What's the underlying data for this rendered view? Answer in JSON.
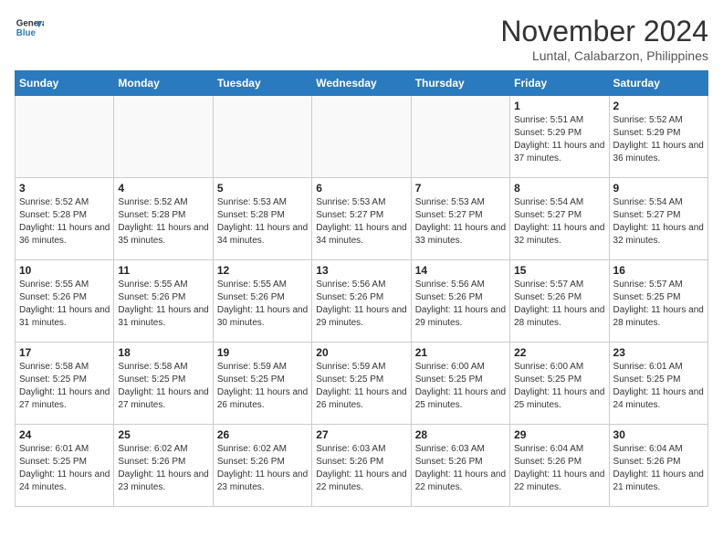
{
  "header": {
    "logo_line1": "General",
    "logo_line2": "Blue",
    "title": "November 2024",
    "subtitle": "Luntal, Calabarzon, Philippines"
  },
  "days_of_week": [
    "Sunday",
    "Monday",
    "Tuesday",
    "Wednesday",
    "Thursday",
    "Friday",
    "Saturday"
  ],
  "weeks": [
    [
      {
        "day": "",
        "info": ""
      },
      {
        "day": "",
        "info": ""
      },
      {
        "day": "",
        "info": ""
      },
      {
        "day": "",
        "info": ""
      },
      {
        "day": "",
        "info": ""
      },
      {
        "day": "1",
        "info": "Sunrise: 5:51 AM\nSunset: 5:29 PM\nDaylight: 11 hours and 37 minutes."
      },
      {
        "day": "2",
        "info": "Sunrise: 5:52 AM\nSunset: 5:29 PM\nDaylight: 11 hours and 36 minutes."
      }
    ],
    [
      {
        "day": "3",
        "info": "Sunrise: 5:52 AM\nSunset: 5:28 PM\nDaylight: 11 hours and 36 minutes."
      },
      {
        "day": "4",
        "info": "Sunrise: 5:52 AM\nSunset: 5:28 PM\nDaylight: 11 hours and 35 minutes."
      },
      {
        "day": "5",
        "info": "Sunrise: 5:53 AM\nSunset: 5:28 PM\nDaylight: 11 hours and 34 minutes."
      },
      {
        "day": "6",
        "info": "Sunrise: 5:53 AM\nSunset: 5:27 PM\nDaylight: 11 hours and 34 minutes."
      },
      {
        "day": "7",
        "info": "Sunrise: 5:53 AM\nSunset: 5:27 PM\nDaylight: 11 hours and 33 minutes."
      },
      {
        "day": "8",
        "info": "Sunrise: 5:54 AM\nSunset: 5:27 PM\nDaylight: 11 hours and 32 minutes."
      },
      {
        "day": "9",
        "info": "Sunrise: 5:54 AM\nSunset: 5:27 PM\nDaylight: 11 hours and 32 minutes."
      }
    ],
    [
      {
        "day": "10",
        "info": "Sunrise: 5:55 AM\nSunset: 5:26 PM\nDaylight: 11 hours and 31 minutes."
      },
      {
        "day": "11",
        "info": "Sunrise: 5:55 AM\nSunset: 5:26 PM\nDaylight: 11 hours and 31 minutes."
      },
      {
        "day": "12",
        "info": "Sunrise: 5:55 AM\nSunset: 5:26 PM\nDaylight: 11 hours and 30 minutes."
      },
      {
        "day": "13",
        "info": "Sunrise: 5:56 AM\nSunset: 5:26 PM\nDaylight: 11 hours and 29 minutes."
      },
      {
        "day": "14",
        "info": "Sunrise: 5:56 AM\nSunset: 5:26 PM\nDaylight: 11 hours and 29 minutes."
      },
      {
        "day": "15",
        "info": "Sunrise: 5:57 AM\nSunset: 5:26 PM\nDaylight: 11 hours and 28 minutes."
      },
      {
        "day": "16",
        "info": "Sunrise: 5:57 AM\nSunset: 5:25 PM\nDaylight: 11 hours and 28 minutes."
      }
    ],
    [
      {
        "day": "17",
        "info": "Sunrise: 5:58 AM\nSunset: 5:25 PM\nDaylight: 11 hours and 27 minutes."
      },
      {
        "day": "18",
        "info": "Sunrise: 5:58 AM\nSunset: 5:25 PM\nDaylight: 11 hours and 27 minutes."
      },
      {
        "day": "19",
        "info": "Sunrise: 5:59 AM\nSunset: 5:25 PM\nDaylight: 11 hours and 26 minutes."
      },
      {
        "day": "20",
        "info": "Sunrise: 5:59 AM\nSunset: 5:25 PM\nDaylight: 11 hours and 26 minutes."
      },
      {
        "day": "21",
        "info": "Sunrise: 6:00 AM\nSunset: 5:25 PM\nDaylight: 11 hours and 25 minutes."
      },
      {
        "day": "22",
        "info": "Sunrise: 6:00 AM\nSunset: 5:25 PM\nDaylight: 11 hours and 25 minutes."
      },
      {
        "day": "23",
        "info": "Sunrise: 6:01 AM\nSunset: 5:25 PM\nDaylight: 11 hours and 24 minutes."
      }
    ],
    [
      {
        "day": "24",
        "info": "Sunrise: 6:01 AM\nSunset: 5:25 PM\nDaylight: 11 hours and 24 minutes."
      },
      {
        "day": "25",
        "info": "Sunrise: 6:02 AM\nSunset: 5:26 PM\nDaylight: 11 hours and 23 minutes."
      },
      {
        "day": "26",
        "info": "Sunrise: 6:02 AM\nSunset: 5:26 PM\nDaylight: 11 hours and 23 minutes."
      },
      {
        "day": "27",
        "info": "Sunrise: 6:03 AM\nSunset: 5:26 PM\nDaylight: 11 hours and 22 minutes."
      },
      {
        "day": "28",
        "info": "Sunrise: 6:03 AM\nSunset: 5:26 PM\nDaylight: 11 hours and 22 minutes."
      },
      {
        "day": "29",
        "info": "Sunrise: 6:04 AM\nSunset: 5:26 PM\nDaylight: 11 hours and 22 minutes."
      },
      {
        "day": "30",
        "info": "Sunrise: 6:04 AM\nSunset: 5:26 PM\nDaylight: 11 hours and 21 minutes."
      }
    ]
  ]
}
